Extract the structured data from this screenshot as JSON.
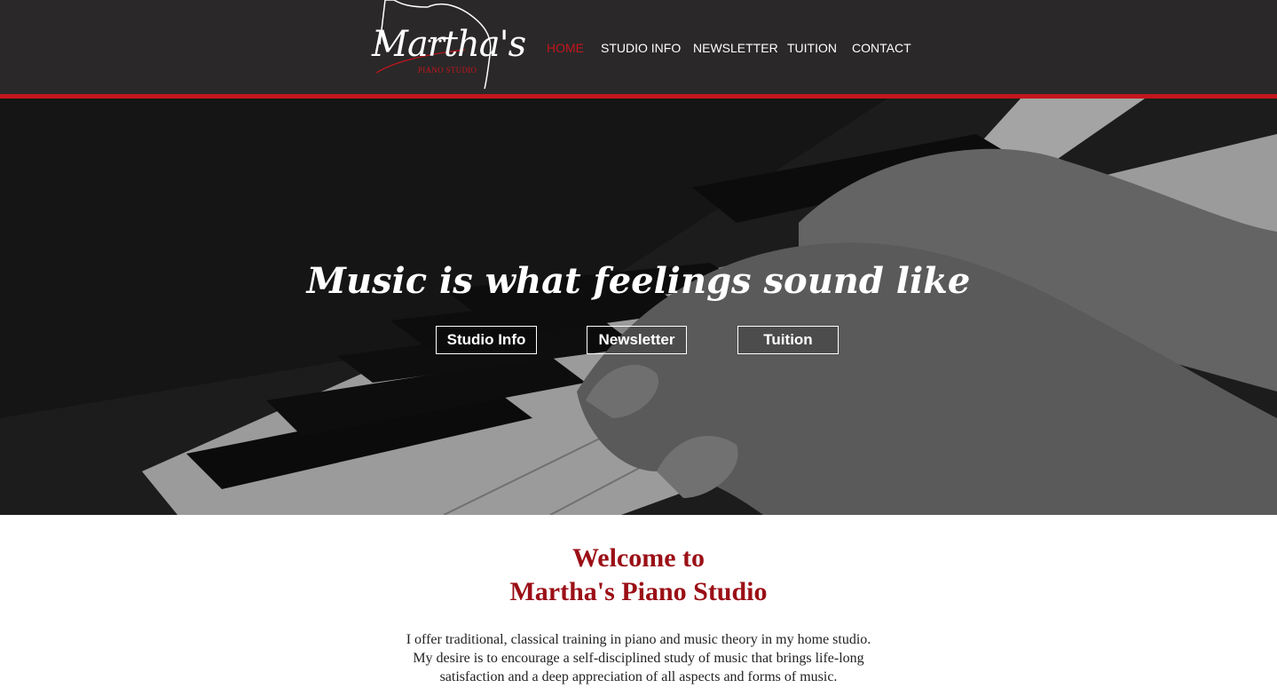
{
  "header": {
    "logo": {
      "name": "Martha's",
      "subtitle": "PIANO STUDIO"
    },
    "nav": [
      {
        "label": "HOME",
        "active": true
      },
      {
        "label": "STUDIO INFO",
        "active": false
      },
      {
        "label": "NEWSLETTER",
        "active": false
      },
      {
        "label": "TUITION",
        "active": false
      },
      {
        "label": "CONTACT",
        "active": false
      }
    ]
  },
  "hero": {
    "tagline": "Music is what feelings sound like",
    "buttons": [
      {
        "label": "Studio Info"
      },
      {
        "label": "Newsletter"
      },
      {
        "label": "Tuition"
      }
    ]
  },
  "welcome": {
    "title_line1": "Welcome to",
    "title_line2": "Martha's Piano Studio",
    "body_line1": "I offer traditional, classical training in piano and music theory in my home studio.",
    "body_line2": "My desire is to encourage a self-disciplined study of music that brings life-long",
    "body_line3": "satisfaction and a deep appreciation of all aspects and forms of music."
  },
  "colors": {
    "header_bg": "#2a2829",
    "accent_red": "#c4161c",
    "title_red": "#9b0f16"
  }
}
